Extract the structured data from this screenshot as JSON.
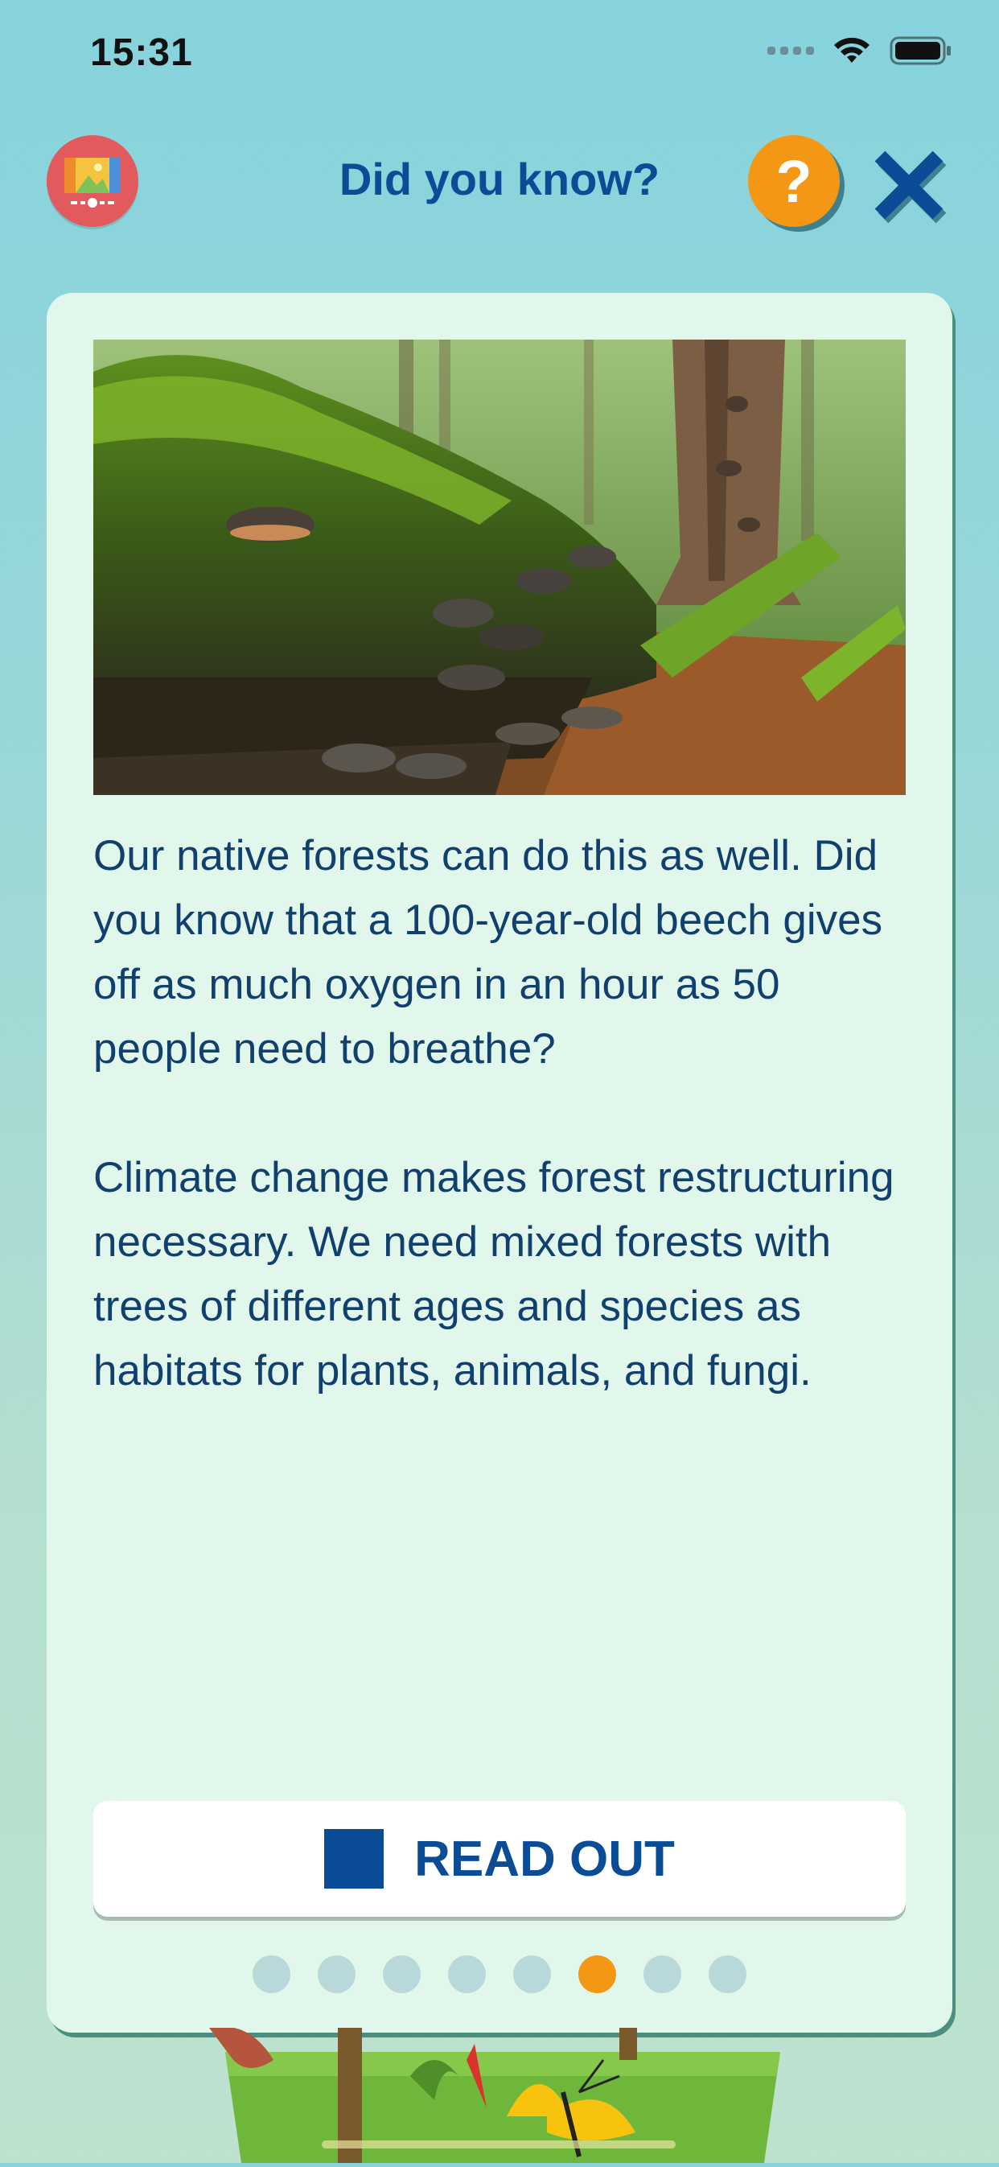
{
  "status": {
    "time": "15:31"
  },
  "header": {
    "title": "Did you know?",
    "help_label": "?"
  },
  "card": {
    "paragraphs": [
      "Our native forests can do this as well. Did you know that a 100-year-old beech gives off as much oxygen in an hour as 50 people need to breathe?",
      "Climate change makes forest restructuring necessary. We need mixed forests with trees of different ages and species as habitats for plants, animals, and fungi."
    ],
    "read_button_label": "READ OUT"
  },
  "pagination": {
    "total": 8,
    "active_index": 5
  },
  "colors": {
    "accent": "#0b4c97",
    "highlight": "#f39714",
    "card_bg": "#e2f7ec"
  },
  "icons": [
    "wifi-icon",
    "battery-icon",
    "gallery-icon",
    "help-icon",
    "close-icon",
    "stop-icon"
  ]
}
